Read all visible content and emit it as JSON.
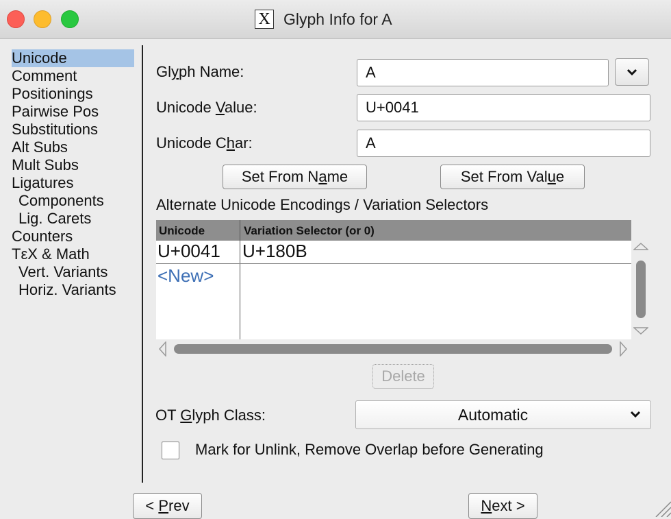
{
  "window": {
    "title": "Glyph Info for A",
    "app_icon": "x-window-icon"
  },
  "sidebar": {
    "items": [
      {
        "label": "Unicode",
        "selected": true
      },
      {
        "label": "Comment"
      },
      {
        "label": "Positionings"
      },
      {
        "label": "Pairwise Pos"
      },
      {
        "label": "Substitutions"
      },
      {
        "label": "Alt Subs"
      },
      {
        "label": "Mult Subs"
      },
      {
        "label": "Ligatures"
      },
      {
        "label": "Components",
        "indent": true
      },
      {
        "label": "Lig. Carets",
        "indent": true
      },
      {
        "label": "Counters"
      },
      {
        "label": "TεX & Math"
      },
      {
        "label": "Vert. Variants",
        "indent": true
      },
      {
        "label": "Horiz. Variants",
        "indent": true
      }
    ]
  },
  "form": {
    "glyph_name": {
      "label_pre": "Gl",
      "label_u": "y",
      "label_post": "ph Name:",
      "value": "A"
    },
    "unicode_value": {
      "label_pre": "Unicode ",
      "label_u": "V",
      "label_post": "alue:",
      "value": "U+0041"
    },
    "unicode_char": {
      "label_pre": "Unicode C",
      "label_u": "h",
      "label_post": "ar:",
      "value": "A"
    },
    "set_from_name": {
      "pre": "Set From N",
      "u": "a",
      "post": "me"
    },
    "set_from_value": {
      "pre": "Set From Val",
      "u": "u",
      "post": "e"
    }
  },
  "alternates": {
    "heading": "Alternate Unicode Encodings / Variation Selectors",
    "columns": [
      "Unicode",
      "Variation Selector (or 0)"
    ],
    "rows": [
      [
        "U+0041",
        "U+180B"
      ]
    ],
    "new_row_label": "<New>",
    "delete_label": "Delete"
  },
  "ot_class": {
    "label_pre": "OT ",
    "label_u": "G",
    "label_post": "lyph Class:",
    "value": "Automatic"
  },
  "unlink": {
    "label": "Mark for Unlink, Remove Overlap before Generating",
    "checked": false
  },
  "nav": {
    "prev": {
      "pre": "< ",
      "u": "P",
      "post": "rev"
    },
    "next": {
      "pre": "",
      "u": "N",
      "post": "ext >"
    }
  },
  "colors": {
    "selection": "#a5c4e6",
    "table_header": "#8e8e8e",
    "new_link": "#3d6fb5"
  }
}
